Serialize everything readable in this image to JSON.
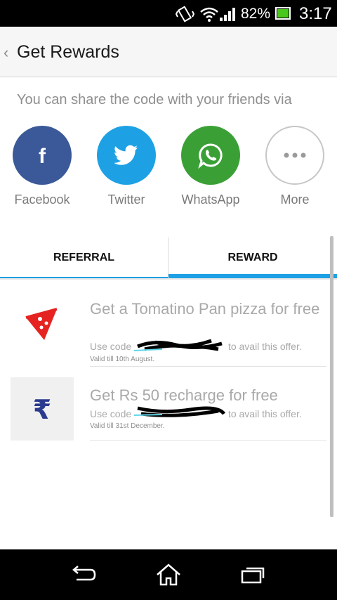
{
  "status_bar": {
    "battery_percent": "82%",
    "time": "3:17",
    "icons": [
      "vibrate-icon",
      "wifi-icon",
      "signal-icon",
      "battery-icon"
    ]
  },
  "header": {
    "title": "Get Rewards",
    "back_icon": "‹"
  },
  "share": {
    "prompt": "You can share the code with your friends via",
    "options": [
      {
        "label": "Facebook",
        "icon": "facebook-icon",
        "color": "#3b5998"
      },
      {
        "label": "Twitter",
        "icon": "twitter-icon",
        "color": "#1ea1e4"
      },
      {
        "label": "WhatsApp",
        "icon": "whatsapp-icon",
        "color": "#3aa036"
      },
      {
        "label": "More",
        "icon": "more-icon",
        "color": "#ffffff"
      }
    ]
  },
  "tabs": [
    {
      "label": "REFERRAL",
      "selected": false
    },
    {
      "label": "REWARD",
      "selected": true
    }
  ],
  "accent_color": "#1ea1e4",
  "offers": [
    {
      "title": "Get a Tomatino Pan pizza for free",
      "use_prefix": "Use code",
      "use_suffix": "to avail this offer.",
      "valid": "Valid till 10th August.",
      "icon": "pizza-icon"
    },
    {
      "title": "Get Rs 50 recharge for free",
      "use_prefix": "Use code",
      "use_suffix": "to avail this offer.",
      "valid": "Valid till 31st December.",
      "icon": "rupee-icon"
    }
  ],
  "nav_bar": {
    "icons": [
      "back-nav-icon",
      "home-nav-icon",
      "recent-apps-icon"
    ]
  }
}
